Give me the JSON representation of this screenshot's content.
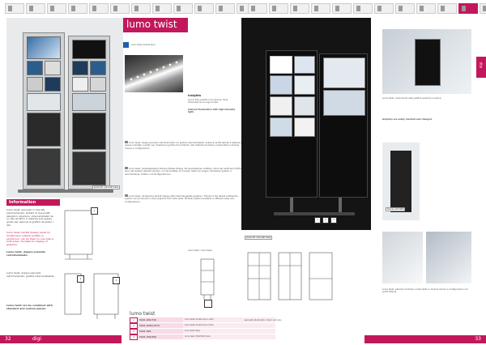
{
  "header": {
    "title": "lumo twist",
    "subtitle": "lumo twist double face"
  },
  "side_tab": {
    "label": "digi"
  },
  "footer": {
    "left_page": "32",
    "left_brand": "digi",
    "right_page": "33"
  },
  "captions": {
    "panel_left": "panel set / pannello base",
    "panel_right": "panel set / pannello base",
    "wall_mount": "banner set kit/kit",
    "bottom_center": "lumo twist / lumo twist",
    "bottom_mid": "pannello illuminato / illum. led plus",
    "icon_numbers": [
      "1",
      "2",
      "3"
    ]
  },
  "info": {
    "heading": "Information",
    "p1": "Lumo twist, pannello in due lati retroilluminato. Dotato di due profili laterali in alluminio, intercambiabili da un lato all'altro. Il sistema può essere girato per esporre la grafica da ambo i lati.",
    "p2": "Lumo twist, backlit display panel for double face. Lateral profiles in aluminium, can be fixed on one side or both sides. Turnable for display of graphics.",
    "p3": "Lumo twist, doppio pannello retroilluminato.",
    "p4": "Lumo twist, doppio pannello retroilluminato, grafica intercambiabile.",
    "note": "Lumo twist can be combined with standard and custom panels."
  },
  "insights": {
    "title": "insights",
    "it": "Led di alta qualità a luce bianca, forte illuminazione e lunga durata.",
    "en": "Indirect illumination with high intensity light."
  },
  "body_text": {
    "it": "Lumo twist, doppio pannello retroilluminato con grafica intercambiabile. Grazie ai profili laterali il sistema può essere orientato e girato per mostrare la grafica da entrambi i lati. Sistema modulare componibile in diverse misure e configurazioni.",
    "de": "Lumo twist, doppelseitiges hinterleuchtetes Display mit wechselbaren Grafiken. Dank der seitlichen Profile kann das System gedreht werden, um die Grafiken von beiden Seiten zu zeigen. Modulares System in verschiedenen Größen und Konfigurationen.",
    "en": "Lumo twist, double face backlit display with interchangeable graphics. Thanks to the lateral profiles the system can be turned to show graphics from both sides. Modular system available in different sizes and configurations."
  },
  "right_text": {
    "it": "Lumo twist, inserimento della grafica semplice e veloce.",
    "en": "Graphics are easily inserted and changed.",
    "bottom": "Lumo twist, sistema modulare componibile in diverse misure e configurazioni con profili laterali."
  },
  "table": {
    "title": "lumo twist",
    "rows": [
      {
        "num": "1",
        "code": "5001.200/720",
        "desc": "lumo twist double face 1 ledh"
      },
      {
        "num": "2",
        "code": "5001.2050/1570",
        "desc": "lumo twist double face 2 ledh"
      },
      {
        "num": "3",
        "code": "5001.394",
        "desc": "lumo twist base"
      },
      {
        "num": "4",
        "code": "5001.700/500",
        "desc": "lumo twist 700x500 frame"
      }
    ]
  },
  "colors": {
    "accent": "#c2185b",
    "background": "#ffffff",
    "panel_dark": "#111111"
  }
}
